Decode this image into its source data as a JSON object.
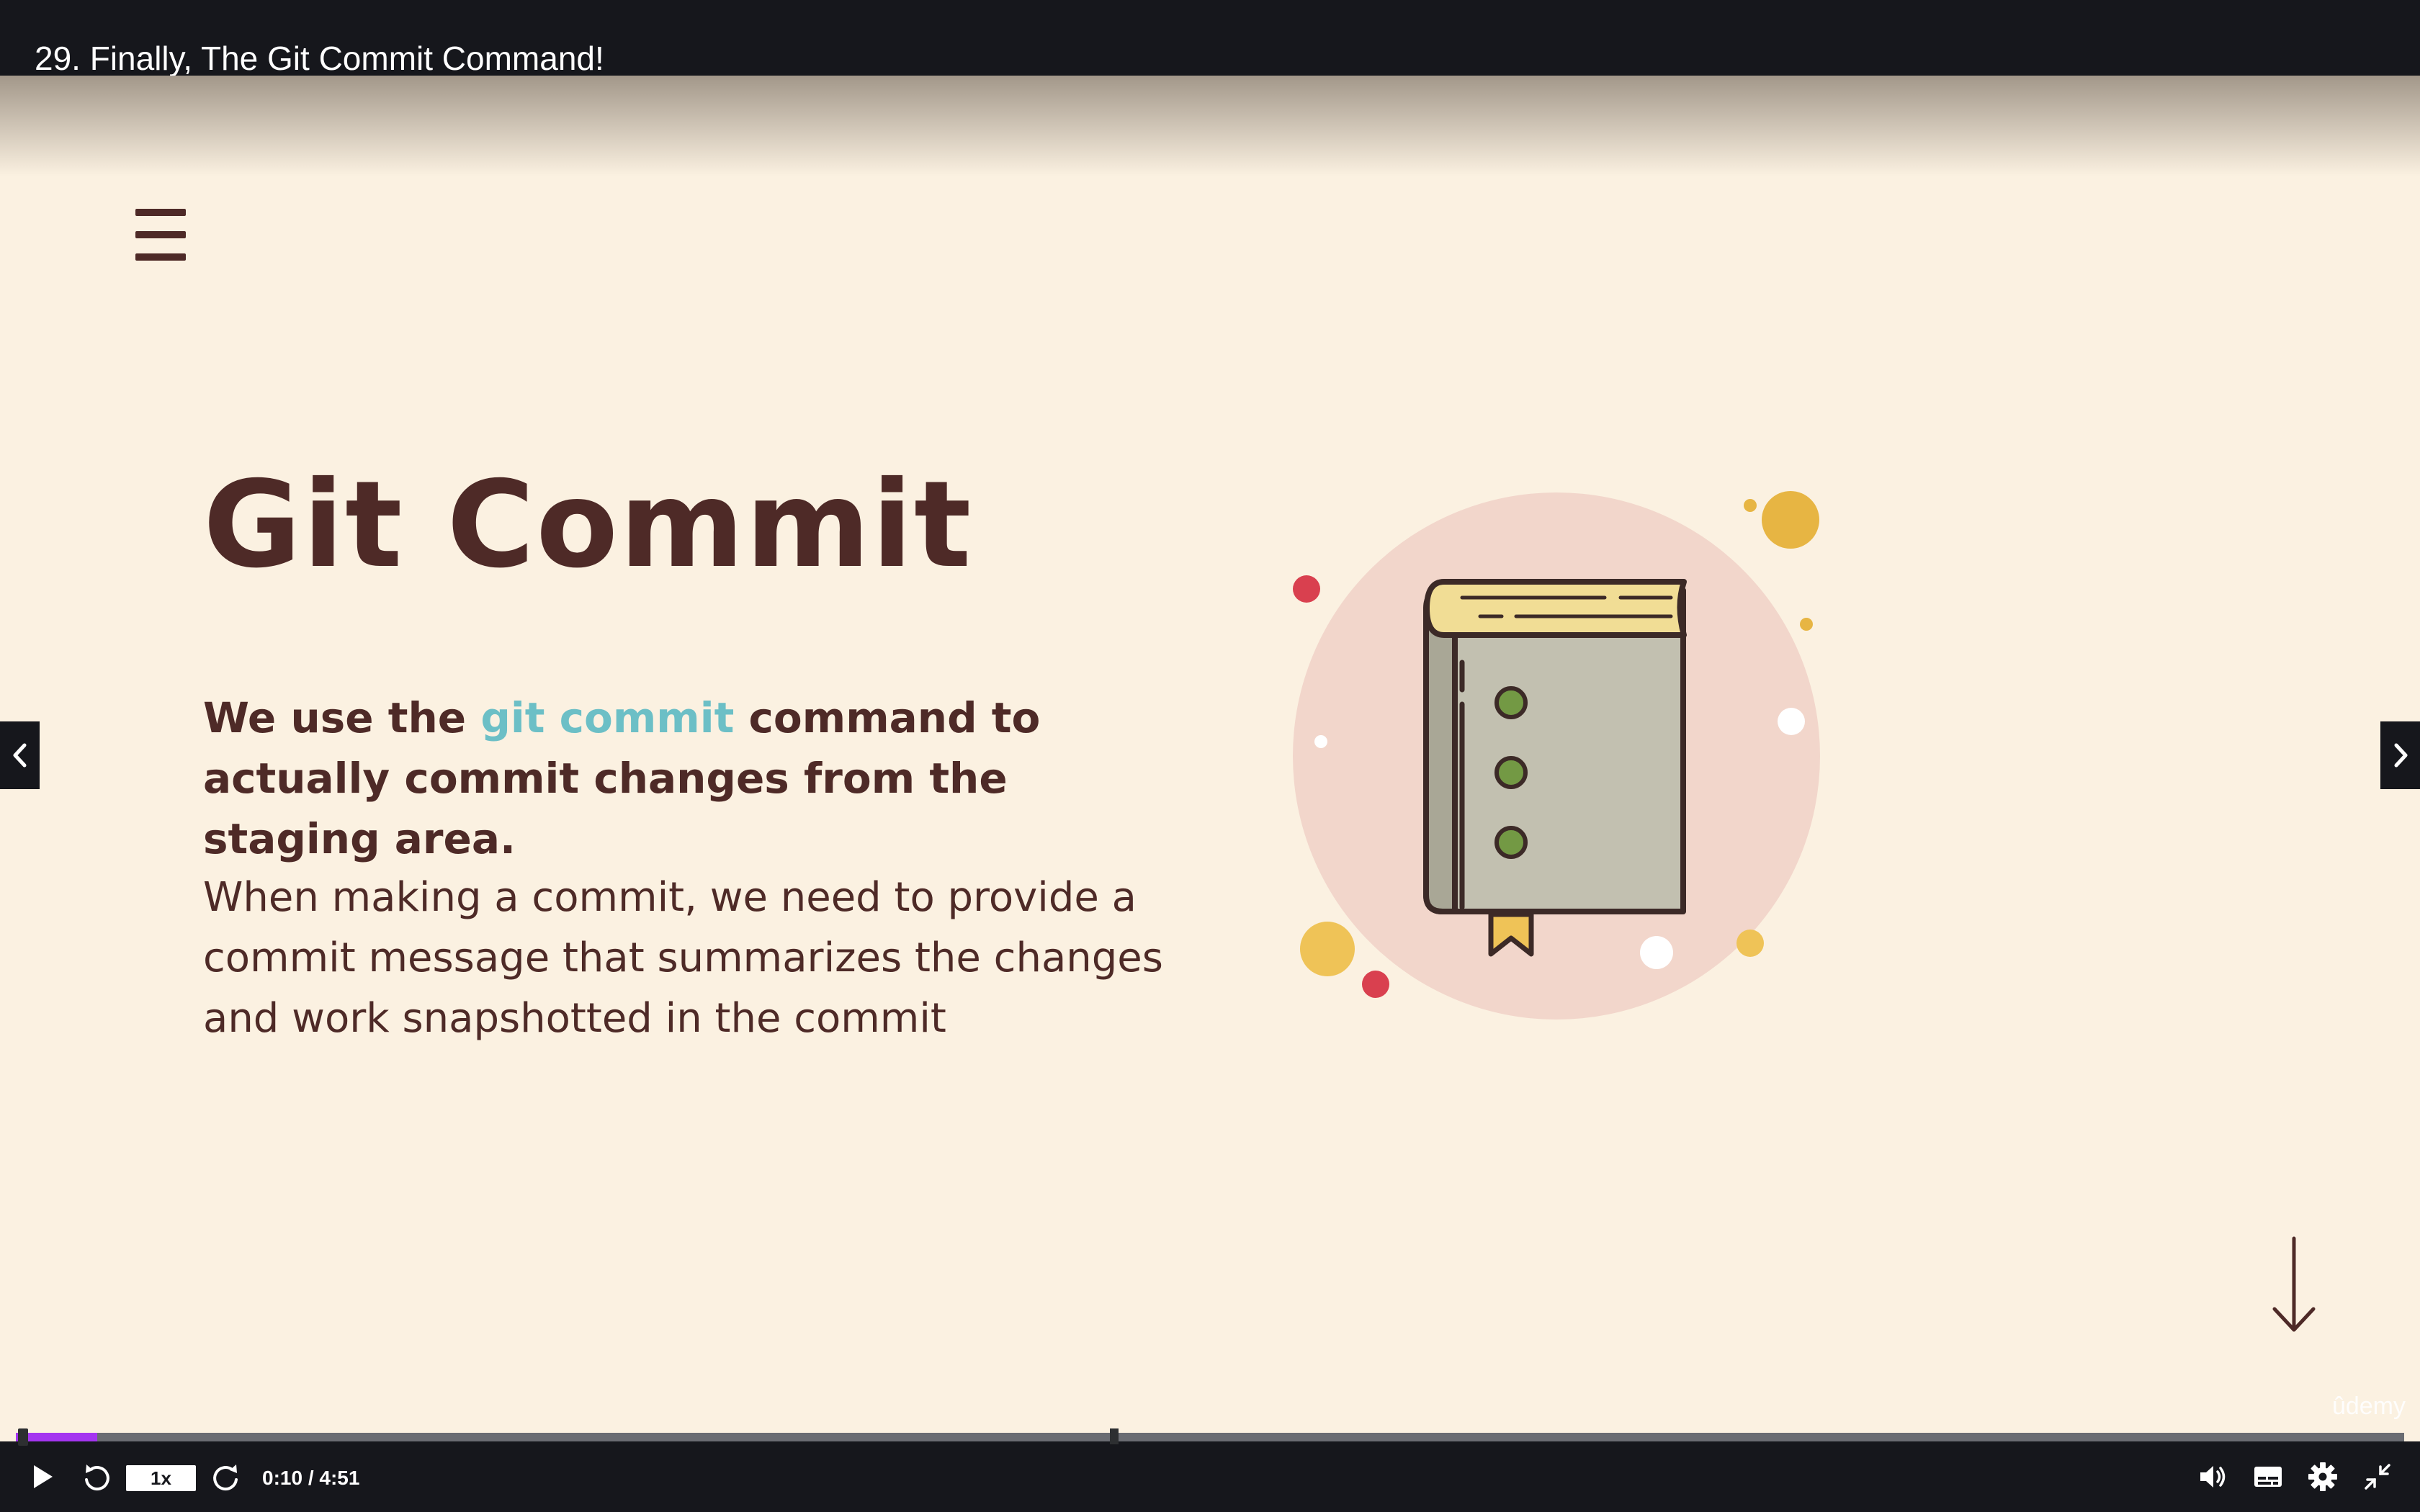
{
  "lecture": {
    "title": "29. Finally, The Git Commit Command!"
  },
  "slide": {
    "heading": "Git Commit",
    "lead_before": "We use the ",
    "lead_highlight": "git commit",
    "lead_after": " command to actually commit changes from the staging area.",
    "body": "When making a commit, we need to provide a commit message that summarizes the changes and work snapshotted in the commit",
    "icons": {
      "menu": "hamburger-menu-icon",
      "illustration": "book-icon",
      "scroll": "arrow-down-icon"
    },
    "colors": {
      "background": "#fbf1e1",
      "text": "#4e2a27",
      "highlight": "#6cbfc6"
    }
  },
  "watermark": "ûdemy",
  "player": {
    "speed_label": "1x",
    "current_time": "0:10",
    "duration": "4:51",
    "time_display": "0:10 / 4:51",
    "progress_fraction": 0.034,
    "bookmark_fraction": 0.458,
    "accent": "#a435f0",
    "icons": {
      "play": "play-icon",
      "rewind": "rewind-5s-icon",
      "forward": "forward-5s-icon",
      "volume": "volume-icon",
      "captions": "captions-icon",
      "settings": "gear-icon",
      "fullscreen": "exit-fullscreen-icon",
      "prev": "chevron-left-icon",
      "next": "chevron-right-icon"
    }
  }
}
